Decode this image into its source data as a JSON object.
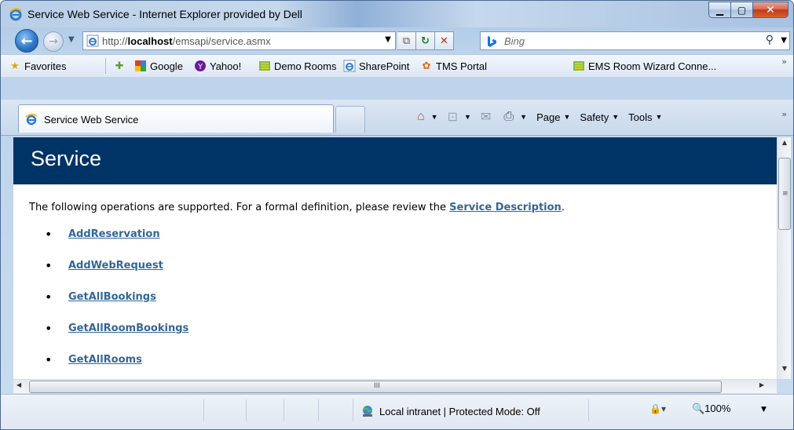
{
  "window": {
    "title": "Service Web Service - Internet Explorer provided by Dell",
    "min_glyph": "▁",
    "max_glyph": "▢",
    "close_glyph": "✕"
  },
  "nav": {
    "back_glyph": "←",
    "fwd_glyph": "→",
    "history_glyph": "▼"
  },
  "address": {
    "url_prefix": "http://",
    "url_host": "localhost",
    "url_path": "/emsapi/service.asmx",
    "drop_glyph": "▼",
    "compat_glyph": "⧉",
    "refresh_glyph": "↻",
    "stop_glyph": "✕"
  },
  "search": {
    "placeholder": "Bing",
    "search_glyph": "⚲",
    "drop_glyph": "▼"
  },
  "favorites": {
    "label": "Favorites",
    "chevron": "»",
    "items": [
      {
        "label": "Google"
      },
      {
        "label": "Yahoo!"
      },
      {
        "label": "Demo Rooms"
      },
      {
        "label": "SharePoint"
      },
      {
        "label": "TMS  Portal"
      },
      {
        "label": "EMS Room Wizard Conne..."
      }
    ]
  },
  "tabs": {
    "active_label": "Service Web Service"
  },
  "commandbar": {
    "page_label": "Page",
    "safety_label": "Safety",
    "tools_label": "Tools",
    "dd_glyph": "▼",
    "chevron": "»"
  },
  "content": {
    "heading": "Service",
    "intro_text": "The following operations are supported. For a formal definition, please review the",
    "intro_link": "Service Description",
    "intro_end": ".",
    "operations": [
      "AddReservation",
      "AddWebRequest",
      "GetAllBookings",
      "GetAllRoomBookings",
      "GetAllRooms"
    ]
  },
  "scroll": {
    "up": "▲",
    "down": "▼",
    "left": "◀",
    "right": "▶",
    "v_grip": "≡",
    "h_grip": "III"
  },
  "status": {
    "zone_text": "Local intranet | Protected Mode: Off",
    "lock_glyph": "🔒▾",
    "zoom_text": "🔍100%",
    "zoom_dd": "▼"
  },
  "colors": {
    "heading_bg": "#003366",
    "link": "#336699"
  }
}
